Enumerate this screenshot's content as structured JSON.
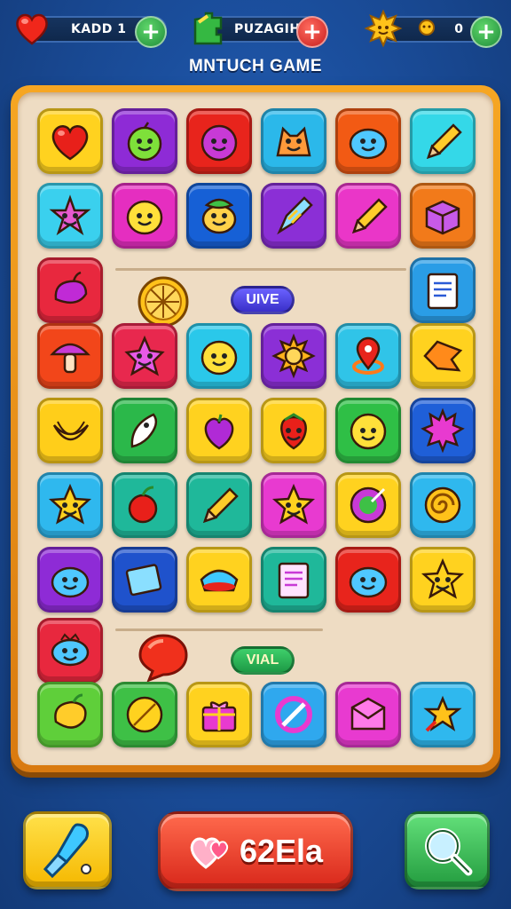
{
  "hud": {
    "lives": {
      "label": "KADD",
      "value": "1"
    },
    "puzzle": {
      "label": "PUZAGIH"
    },
    "stars": {
      "value": "0"
    }
  },
  "title": "MNTUCH GAME",
  "board": {
    "tags": [
      "UIVE",
      "VIAL"
    ],
    "rows": [
      [
        {
          "icon": "heart-icon",
          "color": "#ffd21f"
        },
        {
          "icon": "apple-face-icon",
          "color": "#8e2bd6"
        },
        {
          "icon": "plum-face-icon",
          "color": "#e8241c"
        },
        {
          "icon": "cat-face-icon",
          "color": "#2bb8ea"
        },
        {
          "icon": "blob-face-icon",
          "color": "#f25a14"
        },
        {
          "icon": "pencil-icon",
          "color": "#34d8e8"
        }
      ],
      [
        {
          "icon": "starfish-icon",
          "color": "#3ad0ee"
        },
        {
          "icon": "lemon-face-icon",
          "color": "#e52ec0"
        },
        {
          "icon": "leaf-face-icon",
          "color": "#1660d6"
        },
        {
          "icon": "rocket-icon",
          "color": "#8b2fd6"
        },
        {
          "icon": "pencil-icon",
          "color": "#ea36c8"
        },
        {
          "icon": "box-icon",
          "color": "#f27a1a"
        }
      ],
      [
        {
          "icon": "pepper-icon",
          "color": "#e8283e"
        },
        null,
        null,
        null,
        null,
        {
          "icon": "notebook-icon",
          "color": "#2a9de6"
        }
      ],
      [
        {
          "icon": "mushroom-icon",
          "color": "#f2461a"
        },
        {
          "icon": "star-creature-icon",
          "color": "#e8284e"
        },
        {
          "icon": "lemon-face-icon",
          "color": "#2ac8ea"
        },
        {
          "icon": "sun-icon",
          "color": "#8b2fd6"
        },
        {
          "icon": "map-pin-icon",
          "color": "#30c4e8"
        },
        {
          "icon": "fish-icon",
          "color": "#ffd21f"
        }
      ],
      [
        {
          "icon": "banana-icon",
          "color": "#ffce1a"
        },
        {
          "icon": "feather-icon",
          "color": "#2bb84a"
        },
        {
          "icon": "grape-icon",
          "color": "#ffd21f"
        },
        {
          "icon": "strawberry-face-icon",
          "color": "#ffd21f"
        },
        {
          "icon": "smiley-icon",
          "color": "#2fbf46"
        },
        {
          "icon": "spiky-ball-icon",
          "color": "#1f5fd8"
        }
      ],
      [
        {
          "icon": "star-face-icon",
          "color": "#2fb8ee"
        },
        {
          "icon": "cherry-icon",
          "color": "#1fb89a"
        },
        {
          "icon": "pencil-icon",
          "color": "#1fb89a"
        },
        {
          "icon": "star-face-icon",
          "color": "#e83ad0"
        },
        {
          "icon": "palette-icon",
          "color": "#ffd21f"
        },
        {
          "icon": "swirl-icon",
          "color": "#2fb8ee"
        }
      ],
      [
        {
          "icon": "blob-face-icon",
          "color": "#8e2bd6"
        },
        {
          "icon": "tablet-icon",
          "color": "#1f52cc"
        },
        {
          "icon": "bowl-icon",
          "color": "#ffd21f"
        },
        {
          "icon": "document-icon",
          "color": "#1fb89a"
        },
        {
          "icon": "blob-face-icon",
          "color": "#e8241c"
        },
        {
          "icon": "star-face-icon",
          "color": "#ffd21f"
        }
      ],
      [
        {
          "icon": "fish-creature-icon",
          "color": "#e8283e"
        },
        null,
        null,
        null,
        null,
        null
      ],
      [
        {
          "icon": "mango-icon",
          "color": "#5fcf3a"
        },
        {
          "icon": "lemon-icon",
          "color": "#3ec046"
        },
        {
          "icon": "gift-box-icon",
          "color": "#ffd21f"
        },
        {
          "icon": "no-sign-icon",
          "color": "#2fa8ee"
        },
        {
          "icon": "envelope-icon",
          "color": "#e83ad0"
        },
        {
          "icon": "star-cluster-icon",
          "color": "#2fb8ee"
        }
      ]
    ]
  },
  "bottom": {
    "main_label": "62Ela"
  }
}
